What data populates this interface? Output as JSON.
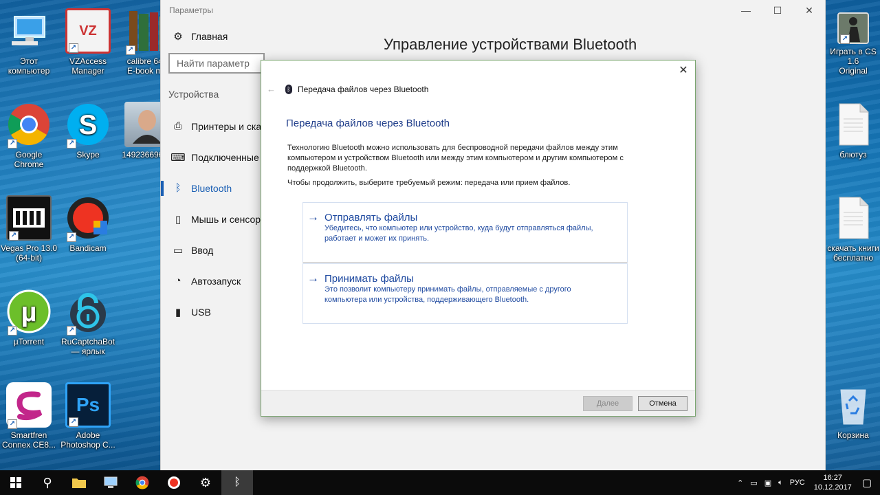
{
  "desktop": {
    "icons": [
      {
        "label": "Этот\nкомпьютер",
        "icon": "this-pc-icon"
      },
      {
        "label": "VZAccess\nManager",
        "icon": "vzaccess-icon"
      },
      {
        "label": "calibre 64b\nE-book ma",
        "icon": "calibre-icon"
      },
      {
        "label": "Google Chrome",
        "icon": "chrome-icon"
      },
      {
        "label": "Skype",
        "icon": "skype-icon"
      },
      {
        "label": "1492366965_",
        "icon": "photo-icon"
      },
      {
        "label": "Vegas Pro 13.0\n(64-bit)",
        "icon": "vegas-icon"
      },
      {
        "label": "Bandicam",
        "icon": "bandicam-icon"
      },
      {
        "label": "µTorrent",
        "icon": "utorrent-icon"
      },
      {
        "label": "RuCaptchaBot\n— ярлык",
        "icon": "rucaptcha-icon"
      },
      {
        "label": "Smartfren\nConnex CE8...",
        "icon": "smartfren-icon"
      },
      {
        "label": "Adobe\nPhotoshop C...",
        "icon": "photoshop-icon"
      },
      {
        "label": "Играть в CS 1.6\nOriginal",
        "icon": "cs-icon"
      },
      {
        "label": "блютуз",
        "icon": "text-file-icon"
      },
      {
        "label": "скачать книги\nбесплатно",
        "icon": "text-file-icon"
      },
      {
        "label": "Корзина",
        "icon": "recycle-bin-icon"
      }
    ]
  },
  "settings": {
    "window_title": "Параметры",
    "page_title": "Управление устройствами Bluetooth",
    "home_label": "Главная",
    "search_placeholder": "Найти параметр",
    "group_label": "Устройства",
    "nav": [
      {
        "label": "Принтеры и ска",
        "icon": "printer-icon"
      },
      {
        "label": "Подключенные",
        "icon": "connected-devices-icon"
      },
      {
        "label": "Bluetooth",
        "icon": "bluetooth-icon"
      },
      {
        "label": "Мышь и сенсор",
        "icon": "mouse-icon"
      },
      {
        "label": "Ввод",
        "icon": "keyboard-icon"
      },
      {
        "label": "Автозапуск",
        "icon": "autoplay-icon"
      },
      {
        "label": "USB",
        "icon": "usb-icon"
      }
    ]
  },
  "dialog": {
    "header_title": "Передача файлов через Bluetooth",
    "heading": "Передача файлов через Bluetooth",
    "description": "Технологию Bluetooth можно использовать для беспроводной передачи файлов между этим компьютером и устройством Bluetooth или между этим компьютером и другим компьютером с поддержкой Bluetooth.",
    "prompt": "Чтобы продолжить, выберите требуемый режим: передача или прием файлов.",
    "options": [
      {
        "title": "Отправлять файлы",
        "description": "Убедитесь, что компьютер или устройство, куда будут отправляться файлы, работает и может их принять."
      },
      {
        "title": "Принимать файлы",
        "description": "Это позволит компьютеру принимать файлы, отправляемые с другого компьютера или устройства, поддерживающего Bluetooth."
      }
    ],
    "next_label": "Далее",
    "cancel_label": "Отмена"
  },
  "taskbar": {
    "language": "РУС",
    "time": "16:27",
    "date": "10.12.2017"
  },
  "colors": {
    "accent": "#1a5fb4",
    "link": "#1f4aa0",
    "taskbar": "#0b0b0b"
  }
}
